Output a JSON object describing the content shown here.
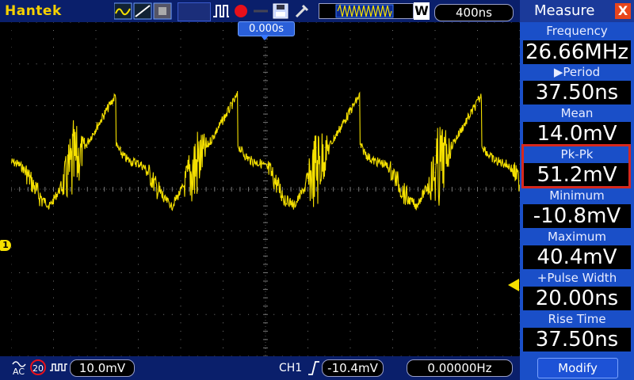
{
  "header": {
    "brand": "Hantek",
    "timebase": "400ns",
    "trigger_position": "0.000s",
    "waveform_mode": "W",
    "icons": [
      "display-mode-icon",
      "cursor-icon",
      "print-icon",
      "pulse-icon",
      "record-icon",
      "save-icon",
      "tools-icon",
      "memory-depth-icon"
    ]
  },
  "channel": {
    "marker": "1",
    "coupling": "AC",
    "bw_limit": "20",
    "volts_div": "10.0mV"
  },
  "trigger": {
    "source": "CH1",
    "level": "-10.4mV",
    "frequency": "0.00000Hz"
  },
  "measure": {
    "title": "Measure",
    "close": "X",
    "items": [
      {
        "label": "Frequency",
        "value": "26.66MHz"
      },
      {
        "label": "▶Period",
        "value": "37.50ns"
      },
      {
        "label": "Mean",
        "value": "14.0mV"
      },
      {
        "label": "Pk-Pk",
        "value": "51.2mV"
      },
      {
        "label": "Minimum",
        "value": "-10.8mV"
      },
      {
        "label": "Maximum",
        "value": "40.4mV"
      },
      {
        "label": "+Pulse Width",
        "value": "20.00ns"
      },
      {
        "label": "Rise Time",
        "value": "37.50ns"
      }
    ],
    "selected": "Pk-Pk",
    "modify": "Modify"
  },
  "colors": {
    "trace": "#f5e000",
    "panel": "#1a4fc8",
    "bars": "#0a1f6b",
    "selected_border": "#d6281e"
  }
}
